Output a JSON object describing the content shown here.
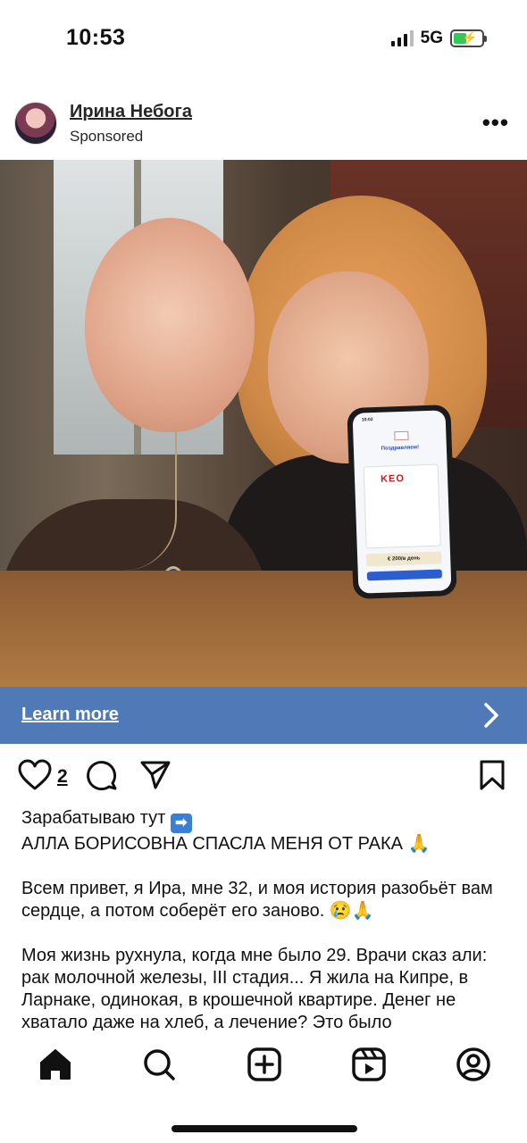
{
  "status_bar": {
    "time": "10:53",
    "network": "5G",
    "battery_color": "#34c759"
  },
  "post": {
    "author": "Ирина Небога",
    "sponsored_label": "Sponsored",
    "more_icon": "more-horizontal-icon",
    "image": {
      "phone_screen": {
        "time": "10:02",
        "title": "Поздравляем!",
        "logo": "KEO",
        "amount": "€ 200/в день"
      }
    },
    "cta": {
      "label": "Learn more",
      "icon": "chevron-right-icon",
      "color": "#5079b7"
    },
    "actions": {
      "like_icon": "heart-icon",
      "like_count": "2",
      "comment_icon": "comment-icon",
      "share_icon": "send-icon",
      "save_icon": "bookmark-icon"
    },
    "caption": {
      "line1": "Зарабатываю тут",
      "line1_emoji": "➡",
      "line2": "АЛЛА БОРИСОВНА СПАСЛА МЕНЯ ОТ РАКА 🙏",
      "para2": "Всем привет, я Ира, мне 32, и моя история разобьёт вам сердце, а потом соберёт его заново. 😢🙏",
      "para3": "Моя жизнь рухнула, когда мне было 29. Врачи сказ али: рак молочной железы, III стадия... Я жила на Кипре, в Ларнаке, одинокая, в крошечной квартире. Денег не хватало даже на хлеб, а лечение? Это было"
    }
  },
  "bottom_nav": {
    "items": [
      "home-icon",
      "search-icon",
      "create-icon",
      "reels-icon",
      "profile-icon"
    ]
  }
}
